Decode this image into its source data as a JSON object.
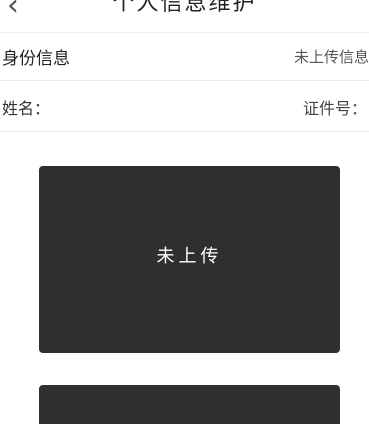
{
  "header": {
    "title": "个人信息维护"
  },
  "section": {
    "label": "身份信息",
    "status": "未上传信息"
  },
  "info_row": {
    "name_label": "姓名：",
    "id_label": "证件号："
  },
  "cards": [
    {
      "status": "未上传"
    },
    {
      "status": ""
    }
  ],
  "colors": {
    "card_background": "#2f2e30",
    "card_text": "#ffffff",
    "divider": "#ebebeb"
  },
  "icons": {
    "back": "chevron-left-icon"
  }
}
